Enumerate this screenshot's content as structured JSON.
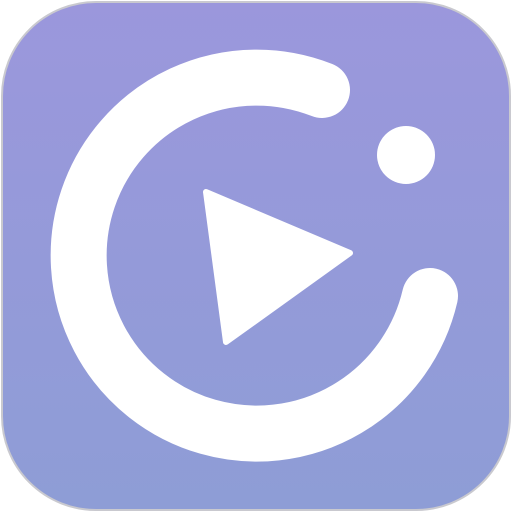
{
  "icon": {
    "name": "video-player-app-icon",
    "glyph": "play-icon",
    "colors": {
      "background_top": "#9b97dc",
      "background_bottom": "#8e9dd6",
      "border": "#c9c9cf",
      "foreground": "#ffffff"
    }
  }
}
